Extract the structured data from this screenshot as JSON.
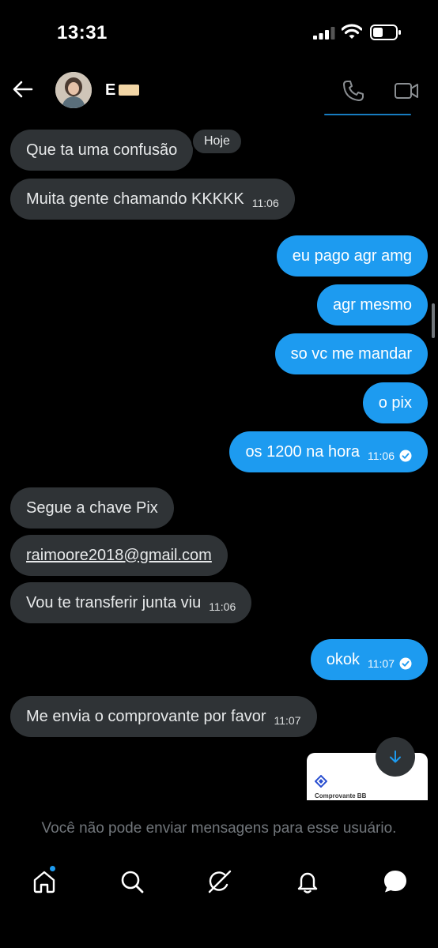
{
  "status_bar": {
    "time": "13:31"
  },
  "header": {
    "contact_name": "E"
  },
  "conversation": {
    "day_label": "Hoje",
    "messages": [
      {
        "dir": "in",
        "text": "Que ta uma confusão",
        "time": ""
      },
      {
        "dir": "in",
        "text": "Muita gente chamando KKKKK",
        "time": "11:06"
      },
      {
        "dir": "out",
        "text": "eu pago agr amg",
        "time": ""
      },
      {
        "dir": "out",
        "text": "agr mesmo",
        "time": ""
      },
      {
        "dir": "out",
        "text": "so vc me mandar",
        "time": ""
      },
      {
        "dir": "out",
        "text": "o pix",
        "time": ""
      },
      {
        "dir": "out",
        "text": "os 1200 na hora",
        "time": "11:06"
      },
      {
        "dir": "in",
        "text": "Segue a chave Pix",
        "time": ""
      },
      {
        "dir": "in",
        "text": "raimoore2018@gmail.com",
        "time": ""
      },
      {
        "dir": "in",
        "text": "Vou te transferir junta viu",
        "time": "11:06"
      },
      {
        "dir": "out",
        "text": "okok",
        "time": "11:07"
      },
      {
        "dir": "in",
        "text": "Me envia o comprovante por favor",
        "time": "11:07"
      }
    ],
    "attachment_label": "Comprovante BB"
  },
  "composer": {
    "restricted_notice": "Você não pode enviar mensagens para esse usuário."
  },
  "nav": {
    "items": [
      "home-icon",
      "search-icon",
      "grok-icon",
      "notifications-icon",
      "messages-icon"
    ]
  },
  "colors": {
    "accent": "#1d9bf0",
    "incoming_bubble": "#2f3336",
    "background": "#000000",
    "muted_text": "#71767b"
  }
}
